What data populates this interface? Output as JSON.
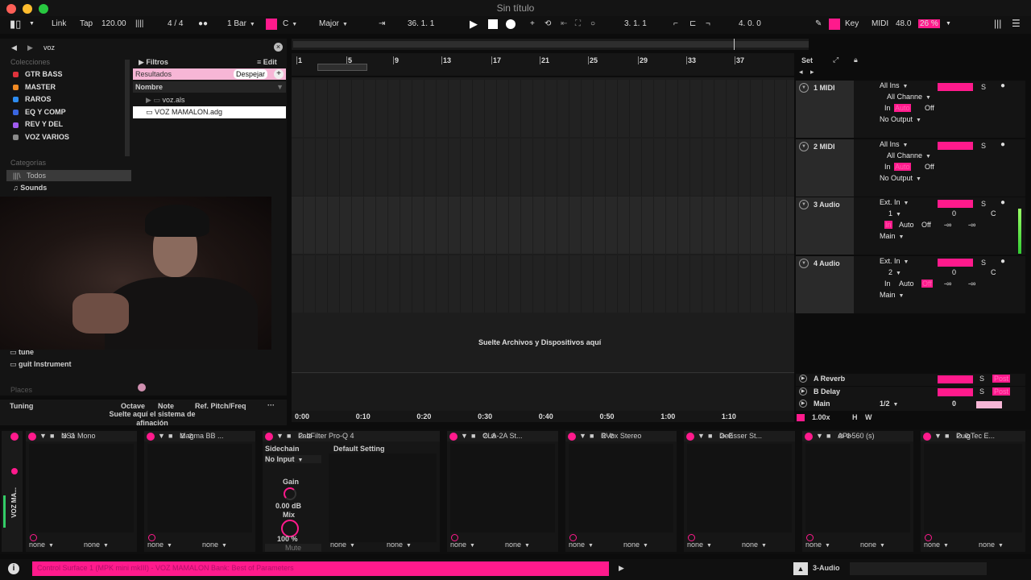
{
  "window": {
    "title": "Sin título"
  },
  "toolbar": {
    "link": "Link",
    "tap": "Tap",
    "tempo": "120.00",
    "signature": "4 / 4",
    "quantize": "1 Bar",
    "key": "C",
    "scale": "Major",
    "position": "36.  1.  1",
    "loop_start": "3.  1.  1",
    "loop_length": "4.  0.  0",
    "key_label": "Key",
    "midi_label": "MIDI",
    "cpu": "48.0",
    "cpu_pct": "26 %"
  },
  "browser": {
    "search": "voz",
    "collections_title": "Colecciones",
    "collections": [
      {
        "label": "GTR BASS",
        "color": "#e0333c"
      },
      {
        "label": "MASTER",
        "color": "#f08a24"
      },
      {
        "label": "RAROS",
        "color": "#2e8cf0"
      },
      {
        "label": "EQ Y COMP",
        "color": "#3a66e0"
      },
      {
        "label": "REV Y DEL",
        "color": "#a15cf0"
      },
      {
        "label": "VOZ VARIOS",
        "color": "#8a8a8a"
      }
    ],
    "categories_title": "Categorías",
    "categories": [
      "Todos",
      "Sounds"
    ],
    "extra": [
      "tune",
      "guit Instrument"
    ],
    "places": "Places",
    "filters": "Filtros",
    "edit": "Edit",
    "results": "Resultados",
    "clear": "Despejar",
    "col_name": "Nombre",
    "files": [
      "voz.als",
      "VOZ MAMALON.adg"
    ]
  },
  "tuning": {
    "title": "Tuning",
    "octave": "Octave",
    "note": "Note",
    "ref": "Ref. Pitch/Freq",
    "drop_hint": "Suelte aquí el sistema de afinación"
  },
  "arrangement": {
    "bars": [
      "1",
      "5",
      "9",
      "13",
      "17",
      "21",
      "25",
      "29",
      "33",
      "37"
    ],
    "times": [
      "0:00",
      "0:10",
      "0:20",
      "0:30",
      "0:40",
      "0:50",
      "1:00",
      "1:10"
    ],
    "drop": "Suelte Archivos y Dispositivos aquí",
    "zoom": "1.00x",
    "h": "H",
    "w": "W",
    "set": "Set"
  },
  "tracks": [
    {
      "name": "1 MIDI",
      "input": "All Ins",
      "channel": "All Channe",
      "monitor": [
        "In",
        "Auto",
        "Off"
      ],
      "output": "No Output"
    },
    {
      "name": "2 MIDI",
      "input": "All Ins",
      "channel": "All Channe",
      "monitor": [
        "In",
        "Auto",
        "Off"
      ],
      "output": "No Output"
    },
    {
      "name": "3 Audio",
      "input": "Ext. In",
      "channel": "1",
      "monitor": [
        "In",
        "Auto",
        "Off"
      ],
      "output": "Main",
      "vol": "0",
      "pan": "C",
      "send_a": "-∞",
      "send_b": "-∞"
    },
    {
      "name": "4 Audio",
      "input": "Ext. In",
      "channel": "2",
      "monitor": [
        "In",
        "Auto",
        "Off"
      ],
      "output": "Main",
      "vol": "0",
      "pan": "C",
      "send_a": "-∞",
      "send_b": "-∞"
    }
  ],
  "returns": [
    {
      "name": "A Reverb",
      "solo": "S",
      "post": "Post"
    },
    {
      "name": "B Delay",
      "solo": "S",
      "post": "Post"
    },
    {
      "name": "Main",
      "out": "1/2",
      "vol": "0"
    }
  ],
  "devices": [
    "NS1 Mono",
    "Magma BB ...",
    "FabFilter Pro-Q 4",
    "CLA-2A St...",
    "RVox Stereo",
    "DeEsser St...",
    "API-560 (s)",
    "PuigTec E..."
  ],
  "device_controls": {
    "sidechain": "Sidechain",
    "no_input": "No Input",
    "gain": "Gain",
    "gain_val": "0.00 dB",
    "mix": "Mix",
    "mix_val": "100 %",
    "mute": "Mute",
    "preset": "Default Setting",
    "none": "none",
    "chain": "VOZ MA..."
  },
  "status": {
    "message": "Control Surface 1 (MPK mini mkIII) - VOZ MAMALON Bank: Best of Parameters",
    "track": "3-Audio"
  }
}
